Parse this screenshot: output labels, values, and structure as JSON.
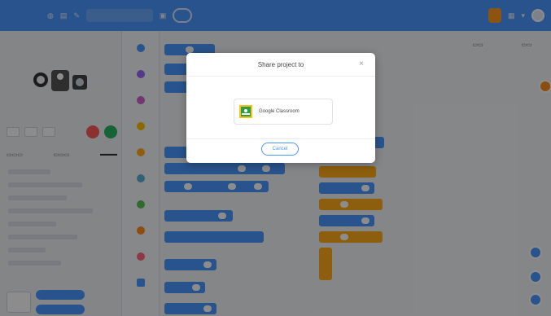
{
  "modal": {
    "title": "Share project to",
    "close_glyph": "×",
    "option_label": "Google Classroom",
    "cancel_label": "Cancel"
  },
  "colors": {
    "brand_blue": "#4c97ff",
    "orange": "#ff9a1f",
    "classroom_green": "#2e9e44",
    "classroom_yellow": "#f7c31a"
  },
  "icons": [
    "close-icon",
    "google-classroom-icon",
    "green-flag-icon",
    "stop-icon",
    "avatar-icon"
  ]
}
